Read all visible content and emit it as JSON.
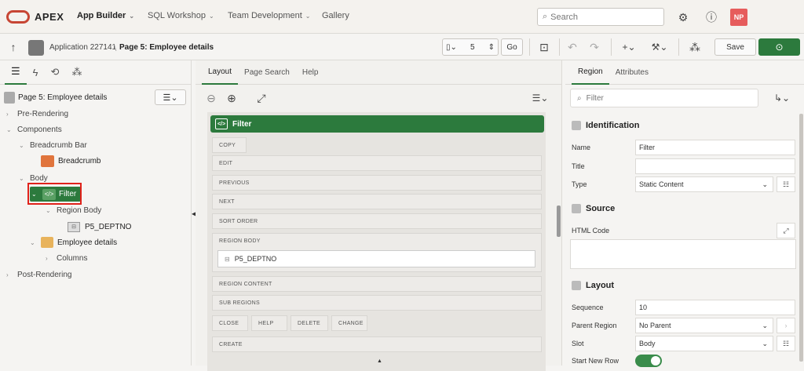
{
  "topnav": {
    "brand": "APEX",
    "items": [
      "App Builder",
      "SQL Workshop",
      "Team Development",
      "Gallery"
    ],
    "search_placeholder": "Search",
    "avatar": "NP"
  },
  "toolbar": {
    "app": "Application 227141",
    "page": "Page 5: Employee details",
    "page_num": "5",
    "go": "Go",
    "save": "Save"
  },
  "left": {
    "header": "Page 5: Employee details",
    "tree": {
      "pre": "Pre-Rendering",
      "components": "Components",
      "breadcrumb_bar": "Breadcrumb Bar",
      "breadcrumb": "Breadcrumb",
      "body": "Body",
      "filter": "Filter",
      "region_body": "Region Body",
      "p5": "P5_DEPTNO",
      "emp": "Employee details",
      "columns": "Columns",
      "post": "Post-Rendering"
    }
  },
  "middle": {
    "tabs": [
      "Layout",
      "Page Search",
      "Help"
    ],
    "region": "Filter",
    "slots": {
      "copy": "COPY",
      "edit": "EDIT",
      "previous": "PREVIOUS",
      "next": "NEXT",
      "sort": "SORT ORDER",
      "region_body": "REGION BODY",
      "item": "P5_DEPTNO",
      "region_content": "REGION CONTENT",
      "sub_regions": "SUB REGIONS",
      "close": "CLOSE",
      "help": "HELP",
      "delete": "DELETE",
      "change": "CHANGE",
      "create": "CREATE"
    }
  },
  "right": {
    "tabs": [
      "Region",
      "Attributes"
    ],
    "filter_placeholder": "Filter",
    "identification": "Identification",
    "name_lbl": "Name",
    "name_val": "Filter",
    "title_lbl": "Title",
    "title_val": "",
    "type_lbl": "Type",
    "type_val": "Static Content",
    "source": "Source",
    "html_lbl": "HTML Code",
    "layout": "Layout",
    "seq_lbl": "Sequence",
    "seq_val": "10",
    "parent_lbl": "Parent Region",
    "parent_val": "No Parent",
    "slot_lbl": "Slot",
    "slot_val": "Body",
    "snr_lbl": "Start New Row"
  },
  "colors": {
    "accent": "#2c7a3d",
    "brand": "#c74634",
    "avatar": "#e65c5c"
  }
}
